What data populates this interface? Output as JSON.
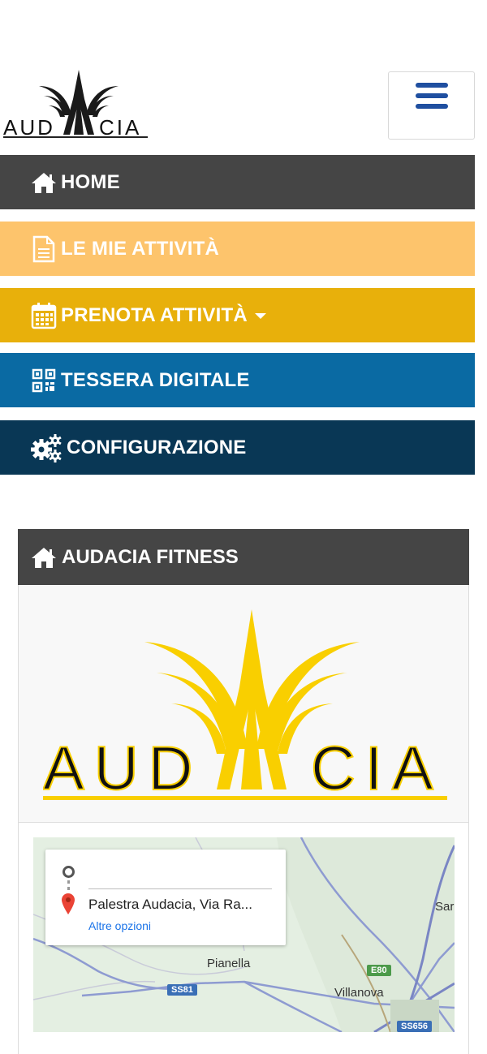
{
  "header": {
    "logo_text": "AUDACIA",
    "menu_icon": "hamburger-icon"
  },
  "nav": {
    "items": [
      {
        "label": "HOME",
        "icon": "home-icon",
        "color": "#454545"
      },
      {
        "label": "LE MIE ATTIVITÀ",
        "icon": "document-icon",
        "color": "#fdc46c"
      },
      {
        "label": "PRENOTA ATTIVITÀ",
        "icon": "calendar-icon",
        "color": "#e8b00b"
      },
      {
        "label": "TESSERA DIGITALE",
        "icon": "qr-code-icon",
        "color": "#0a6aa3"
      },
      {
        "label": "CONFIGURAZIONE",
        "icon": "gears-icon",
        "color": "#093755"
      }
    ]
  },
  "panel": {
    "title": "AUDACIA FITNESS",
    "icon": "home-icon",
    "logo_text": "AUDACIA",
    "brand_yellow": "#f9cf00"
  },
  "map": {
    "destination": "Palestra Audacia, Via Ra...",
    "more_options": "Altre opzioni",
    "places": [
      "Pianella",
      "Villanova",
      "Sar"
    ],
    "roads": [
      "SS81",
      "E80",
      "SS656"
    ]
  }
}
